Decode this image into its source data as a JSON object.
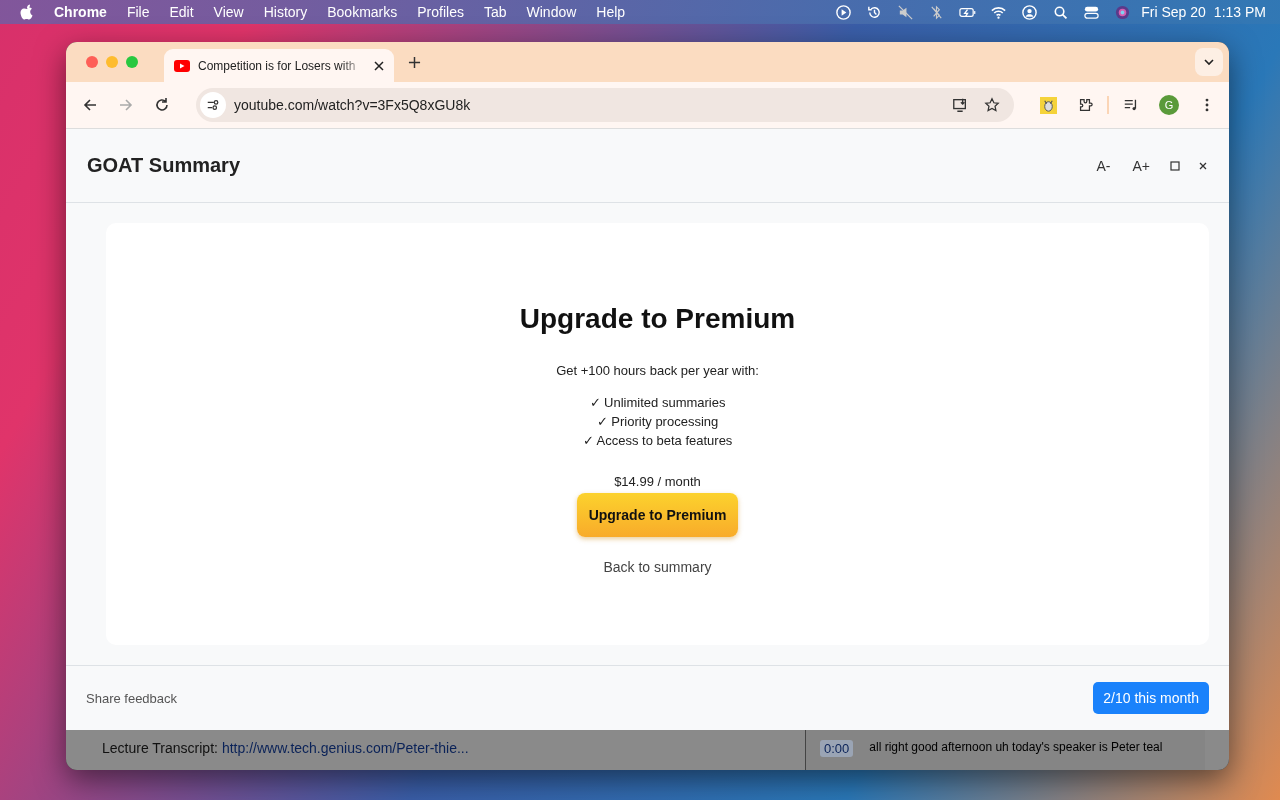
{
  "menu_bar": {
    "app": "Chrome",
    "items": [
      "File",
      "Edit",
      "View",
      "History",
      "Bookmarks",
      "Profiles",
      "Tab",
      "Window",
      "Help"
    ],
    "date": "Fri Sep 20",
    "time": "1:13 PM"
  },
  "browser": {
    "tabs": [
      {
        "title": "Competition is for Losers with",
        "selected": true
      }
    ],
    "url": "youtube.com/watch?v=3Fx5Q8xGU8k",
    "profile_initial": "G"
  },
  "panel": {
    "title": "GOAT Summary",
    "text_controls": [
      "A-",
      "A+"
    ]
  },
  "upgrade": {
    "heading": "Upgrade to Premium",
    "subtitle": "Get +100 hours back per year with:",
    "features": [
      "✓ Unlimited summaries",
      "✓ Priority processing",
      "✓ Access to beta features"
    ],
    "price": "$14.99 / month",
    "button": "Upgrade to Premium",
    "back_link": "Back to summary"
  },
  "footer": {
    "feedback": "Share feedback",
    "usage": "2/10 this month"
  },
  "background_page": {
    "transcript_label": "Lecture Transcript:",
    "transcript_link": "http://www.tech.genius.com/Peter-thie...",
    "timestamp": "0:00",
    "transcript_line": "all right good afternoon uh today's speaker is Peter teal"
  }
}
